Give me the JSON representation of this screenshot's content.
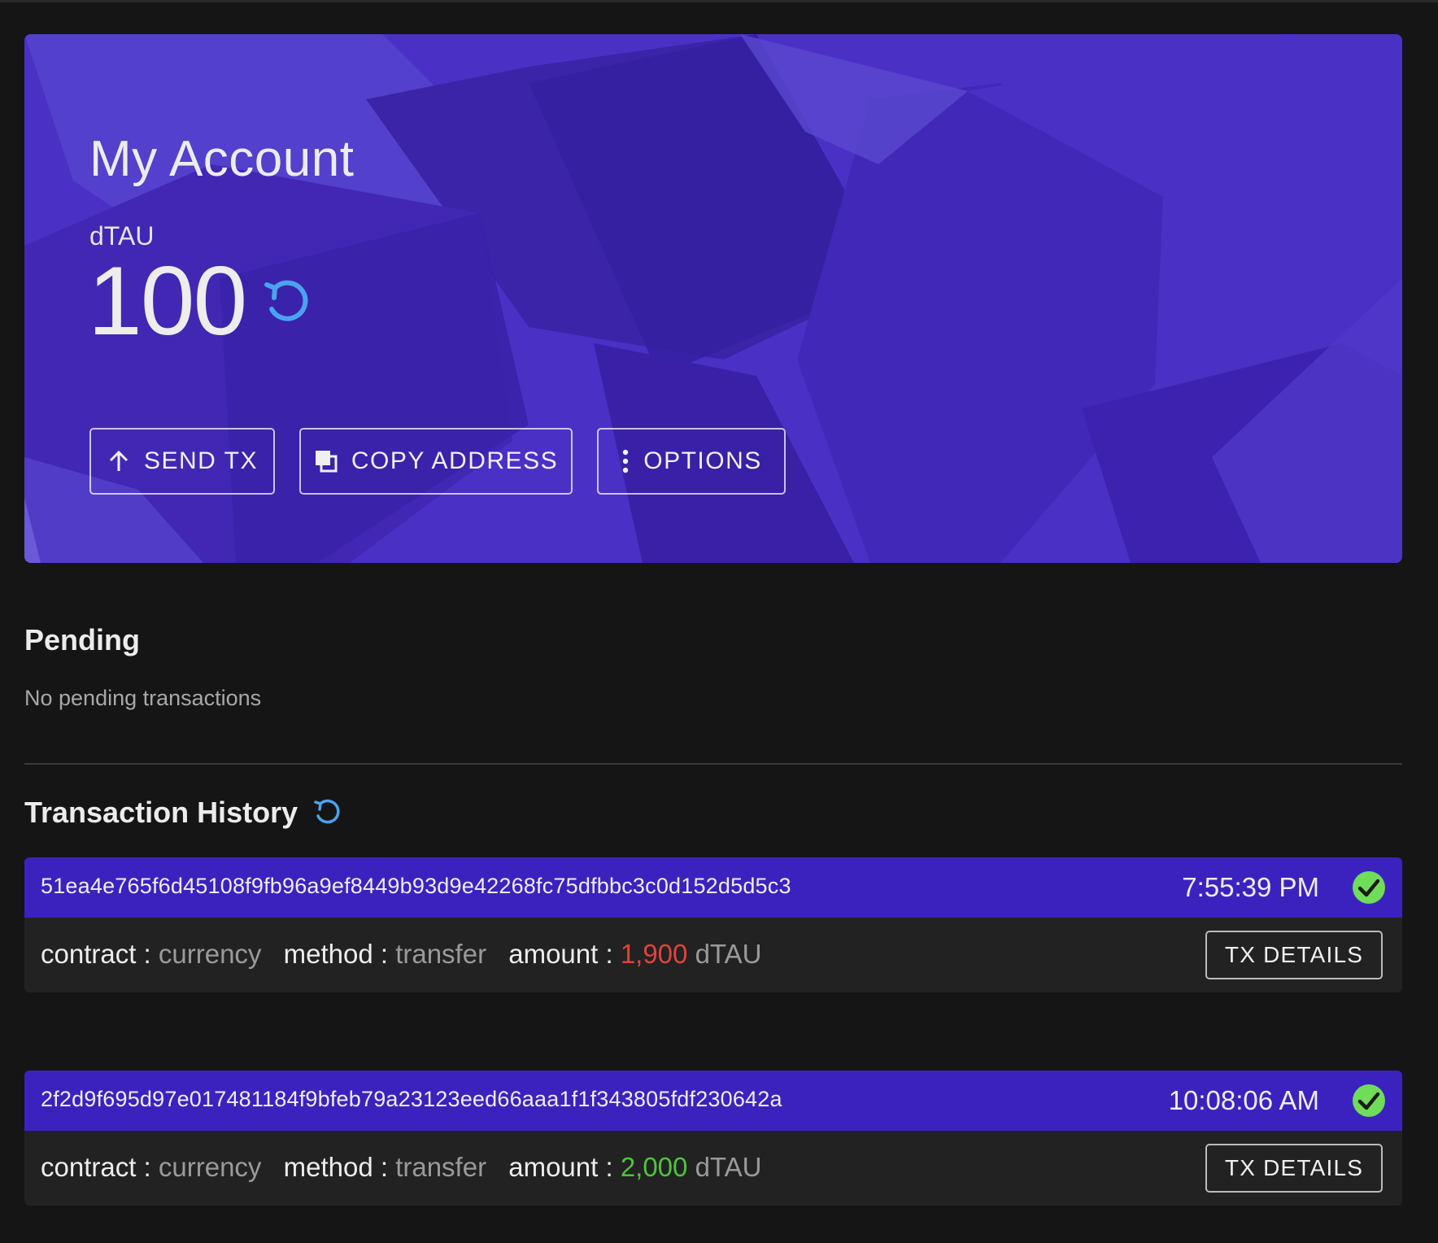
{
  "account": {
    "title": "My Account",
    "unit": "dTAU",
    "balance": "100",
    "refresh_icon": "refresh-icon"
  },
  "actions": {
    "send_label": "SEND TX",
    "send_icon": "arrow-up-icon",
    "copy_label": "COPY ADDRESS",
    "copy_icon": "copy-icon",
    "options_label": "OPTIONS",
    "options_icon": "more-vertical-icon"
  },
  "pending": {
    "title": "Pending",
    "empty_text": "No pending transactions"
  },
  "history": {
    "title": "Transaction History",
    "refresh_icon": "refresh-icon",
    "details_label": "TX DETAILS",
    "contract_key": "contract :",
    "method_key": "method :",
    "amount_key": "amount :",
    "items": [
      {
        "hash": "51ea4e765f6d45108f9fb96a9ef8449b93d9e42268fc75dfbbc3c0d152d5d5c3",
        "time": "7:55:39 PM",
        "status": "success",
        "contract": "currency",
        "method": "transfer",
        "amount": "1,900",
        "direction": "outgoing",
        "unit": "dTAU"
      },
      {
        "hash": "2f2d9f695d97e017481184f9bfeb79a23123eed66aaa1f1f343805fdf230642a",
        "time": "10:08:06 AM",
        "status": "success",
        "contract": "currency",
        "method": "transfer",
        "amount": "2,000",
        "direction": "incoming",
        "unit": "dTAU"
      }
    ]
  },
  "colors": {
    "background": "#151515",
    "hero": "#4b30c6",
    "tx_header": "#3b22bf",
    "tx_body": "#222222",
    "accent_blue": "#4aa3f0",
    "negative": "#e0443a",
    "positive": "#4cc63a",
    "success_check": "#6fdc5a"
  }
}
